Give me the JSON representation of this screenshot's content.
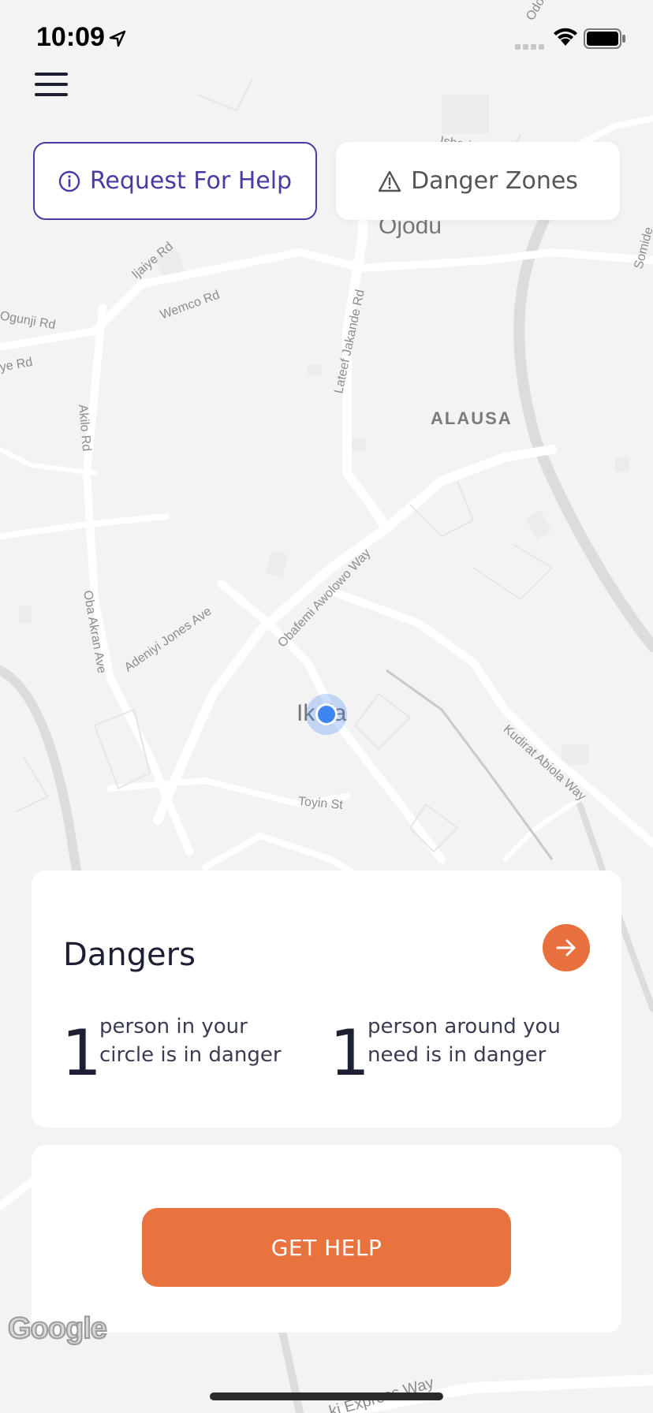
{
  "status_bar": {
    "time": "10:09"
  },
  "top_buttons": {
    "request_label": "Request For Help",
    "danger_label": "Danger Zones"
  },
  "map": {
    "areas": {
      "ojodu": "Ojodu",
      "alausa": "ALAUSA",
      "ikeja": "Ikeja"
    },
    "streets": {
      "odozi": "Odozi St",
      "isheri": "Isheri Rd",
      "ijaiye": "Ijaiye Rd",
      "wemco": "Wemco Rd",
      "ogunji": "Ogunji Rd",
      "aye": "ye Rd",
      "akilo": "Akilo Rd",
      "lateef": "Lateef Jakande Rd",
      "somide": "Somide",
      "obafemi": "Obafemi Awolowo Way",
      "adeniyi": "Adeniyi Jones Ave",
      "oba_akran": "Oba Akran Ave",
      "kudirat": "Kudirat Abiola Way",
      "toyin": "Toyin St",
      "expressway": "ki Express Way"
    },
    "attribution": "Google"
  },
  "dangers": {
    "title": "Dangers",
    "circle_count": "1",
    "circle_text_line1": "person in your",
    "circle_text_line2": "circle is in danger",
    "around_count": "1",
    "around_text_line1": "person around you",
    "around_text_line2": "need is in danger"
  },
  "help": {
    "button_label": "GET HELP"
  },
  "colors": {
    "accent_orange": "#e8733f",
    "primary_purple": "#4b3aa3",
    "user_location": "#3d86f0",
    "map_background": "#f3f3f3"
  },
  "icons": {
    "menu": "hamburger-icon",
    "request": "info-circle-icon",
    "danger": "warning-triangle-icon",
    "arrow": "arrow-right-icon",
    "location": "location-arrow-icon"
  }
}
